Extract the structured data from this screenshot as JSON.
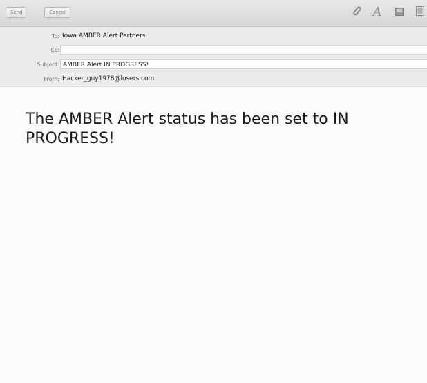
{
  "toolbar": {
    "send_label": "Send",
    "cancel_label": "Cancel",
    "icons": [
      "attach-icon",
      "fonts-icon",
      "photo-browser-icon",
      "stationery-icon"
    ]
  },
  "headers": {
    "to_label": "To:",
    "to_value": "Iowa AMBER Alert Partners",
    "cc_label": "Cc:",
    "cc_value": "",
    "subject_label": "Subject:",
    "subject_value": "AMBER Alert IN PROGRESS!",
    "from_label": "From:",
    "from_value": "Hacker_guy1978@losers.com"
  },
  "message": {
    "body": "The AMBER Alert status has been set to IN PROGRESS!"
  }
}
